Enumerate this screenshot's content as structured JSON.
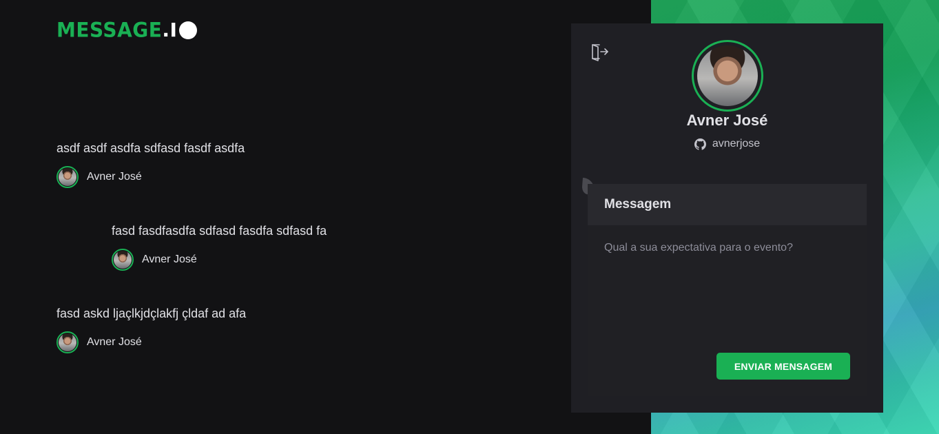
{
  "logo": {
    "brand": "MESSAGE",
    "dot": ".",
    "io": "I"
  },
  "messages": [
    {
      "text": "asdf asdf asdfa sdfasd fasdf asdfa",
      "user": "Avner José"
    },
    {
      "text": "fasd fasdfasdfa sdfasd fasdfa sdfasd fa",
      "user": "Avner José"
    },
    {
      "text": "fasd askd ljaçlkjdçlakfj çldaf ad afa",
      "user": "Avner José"
    }
  ],
  "profile": {
    "name": "Avner José",
    "login": "avnerjose"
  },
  "form": {
    "header": "Messagem",
    "placeholder": "Qual a sua expectativa para o evento?",
    "value": "",
    "submit_label": "ENVIAR MENSAGEM"
  },
  "colors": {
    "accent": "#1ab054",
    "background": "#121214",
    "panel": "#1f1f24"
  },
  "icons": {
    "signout": "sign-out-icon",
    "github": "github-icon"
  }
}
